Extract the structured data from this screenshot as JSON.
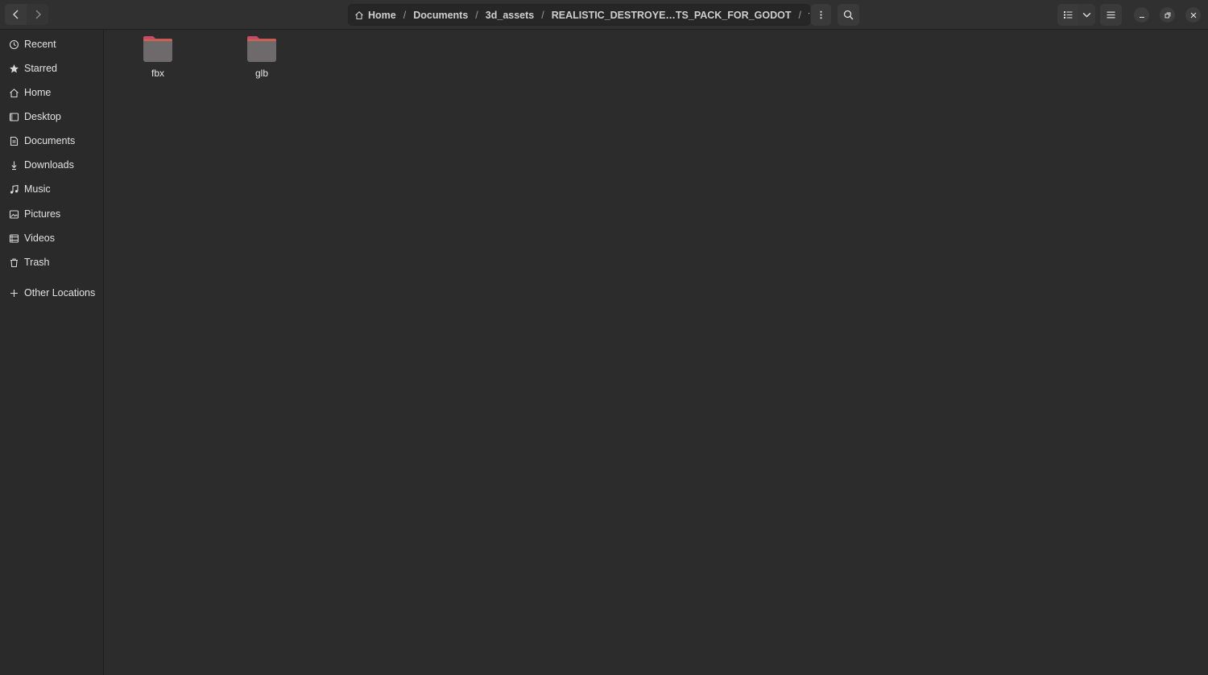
{
  "headerbar": {
    "breadcrumbs": [
      {
        "label": "Home",
        "icon": "home-icon"
      },
      {
        "label": "Documents"
      },
      {
        "label": "3d_assets"
      },
      {
        "label": "REALISTIC_DESTROYE…TS_PACK_FOR_GODOT"
      },
      {
        "label": "formats",
        "current": true
      }
    ],
    "separator": "/"
  },
  "sidebar": {
    "items": [
      {
        "label": "Recent",
        "icon": "clock-icon"
      },
      {
        "label": "Starred",
        "icon": "star-icon"
      },
      {
        "label": "Home",
        "icon": "home-icon"
      },
      {
        "label": "Desktop",
        "icon": "desktop-icon"
      },
      {
        "label": "Documents",
        "icon": "document-icon"
      },
      {
        "label": "Downloads",
        "icon": "download-icon"
      },
      {
        "label": "Music",
        "icon": "music-icon"
      },
      {
        "label": "Pictures",
        "icon": "picture-icon"
      },
      {
        "label": "Videos",
        "icon": "video-icon"
      },
      {
        "label": "Trash",
        "icon": "trash-icon"
      }
    ],
    "other_locations": {
      "label": "Other Locations",
      "icon": "plus-icon"
    }
  },
  "files": [
    {
      "name": "fbx",
      "type": "folder"
    },
    {
      "name": "glb",
      "type": "folder"
    }
  ],
  "colors": {
    "folder_tab": "#c94b6b",
    "folder_body": "#6e6a6c",
    "background": "#2c2c2c",
    "sidebar": "#2a2a2a"
  }
}
